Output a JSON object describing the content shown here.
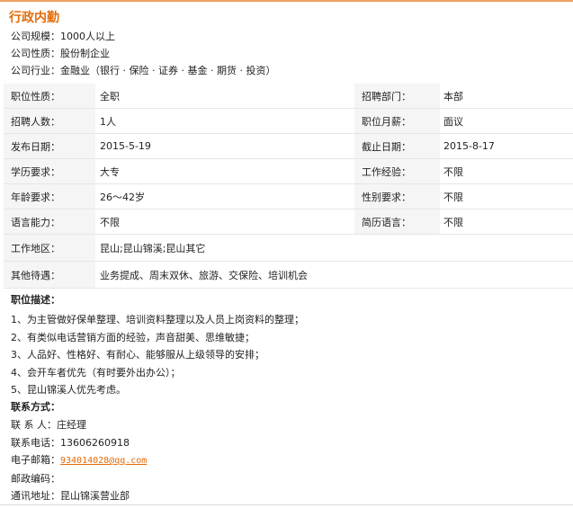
{
  "job": {
    "title": "行政内勤"
  },
  "company": {
    "size": "公司规模：1000人以上",
    "nature": "公司性质：股份制企业",
    "industry": "公司行业：金融业（银行 · 保险 · 证券 · 基金 · 期货 · 投资）"
  },
  "info_rows": [
    {
      "l1": "职位性质：",
      "v1": "全职",
      "l2": "招聘部门：",
      "v2": "本部"
    },
    {
      "l1": "招聘人数：",
      "v1": "1人",
      "l2": "职位月薪：",
      "v2": "面议"
    },
    {
      "l1": "发布日期：",
      "v1": "2015-5-19",
      "l2": "截止日期：",
      "v2": "2015-8-17"
    },
    {
      "l1": "学历要求：",
      "v1": "大专",
      "l2": "工作经验：",
      "v2": "不限"
    },
    {
      "l1": "年龄要求：",
      "v1": "26～42岁",
      "l2": "性别要求：",
      "v2": "不限"
    },
    {
      "l1": "语言能力：",
      "v1": "不限",
      "l2": "简历语言：",
      "v2": "不限"
    }
  ],
  "work_area": {
    "label": "工作地区：",
    "value": "昆山;昆山锦溪;昆山其它"
  },
  "benefits": {
    "label": "其他待遇：",
    "value": "业务提成、周末双休、旅游、交保险、培训机会"
  },
  "description": {
    "heading": "职位描述：",
    "items": [
      "1、为主管做好保单整理、培训资料整理以及人员上岗资料的整理；",
      "2、有类似电话营销方面的经验，声音甜美、思维敏捷；",
      "3、人品好、性格好、有耐心、能够服从上级领导的安排；",
      "4、会开车者优先（有时要外出办公）；",
      "5、昆山锦溪人优先考虑。"
    ]
  },
  "contact": {
    "heading": "联系方式：",
    "person": "联 系 人：庄经理",
    "phone": "联系电话：13606260918",
    "email_label": "电子邮箱：",
    "email": "934014028@qq.com",
    "postcode": "邮政编码：",
    "address": "通讯地址：昆山锦溪营业部"
  }
}
